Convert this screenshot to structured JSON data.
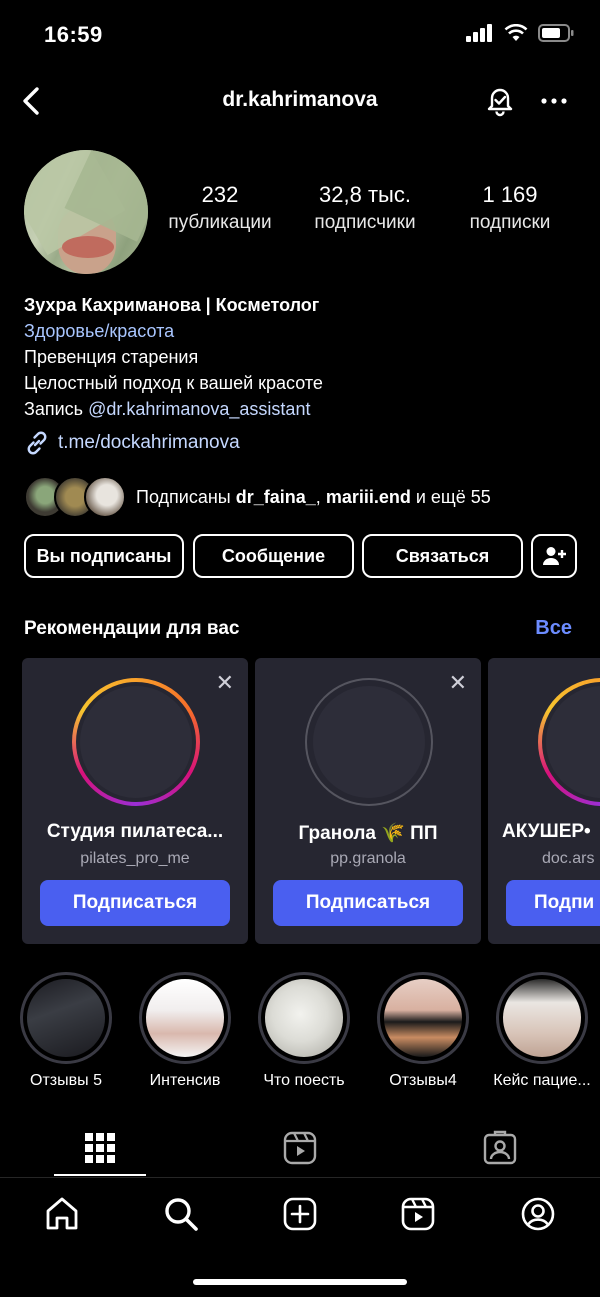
{
  "status_bar": {
    "time": "16:59"
  },
  "header": {
    "username": "dr.kahrimanova",
    "icons": [
      "chevron-left-icon",
      "bell-icon",
      "more-icon"
    ]
  },
  "profile": {
    "stats": [
      {
        "value": "232",
        "label": "публикации"
      },
      {
        "value": "32,8 тыс.",
        "label": "подписчики"
      },
      {
        "value": "1 169",
        "label": "подписки"
      }
    ],
    "name": "Зухра Кахриманова | Косметолог",
    "category": "Здоровье/красота",
    "bio_lines": [
      "Превенция старения",
      "Целостный подход к вашей красоте"
    ],
    "booking_prefix": "Запись ",
    "booking_handle": "@dr.kahrimanova_assistant",
    "link": "t.me/dockahrimanova",
    "followed_by": {
      "prefix": "Подписаны ",
      "user1": "dr_faina_",
      "sep": ", ",
      "user2": "mariii.end",
      "suffix": " и ещё 55"
    }
  },
  "actions": {
    "following_label": "Вы подписаны",
    "message_label": "Сообщение",
    "contact_label": "Связаться"
  },
  "recommendations": {
    "title": "Рекомендации для вас",
    "see_all": "Все",
    "close_glyph": "✕",
    "cards": [
      {
        "name": "Студия пилатеса...",
        "handle": "pilates_pro_me",
        "button": "Подписаться"
      },
      {
        "name": "Гранола 🌾 ПП",
        "handle": "pp.granola",
        "button": "Подписаться"
      },
      {
        "name": "АКУШЕР•",
        "handle": "doc.ars",
        "button": "Подпи"
      }
    ]
  },
  "highlights": [
    {
      "label": "Отзывы 5"
    },
    {
      "label": "Интенсив"
    },
    {
      "label": "Что поесть"
    },
    {
      "label": "Отзывы4"
    },
    {
      "label": "Кейс пацие..."
    }
  ],
  "colors": {
    "accent_blue": "#4a5ff0",
    "link_blue": "#a9c6ff",
    "see_all": "#6c8cff",
    "card_bg": "#262631"
  }
}
